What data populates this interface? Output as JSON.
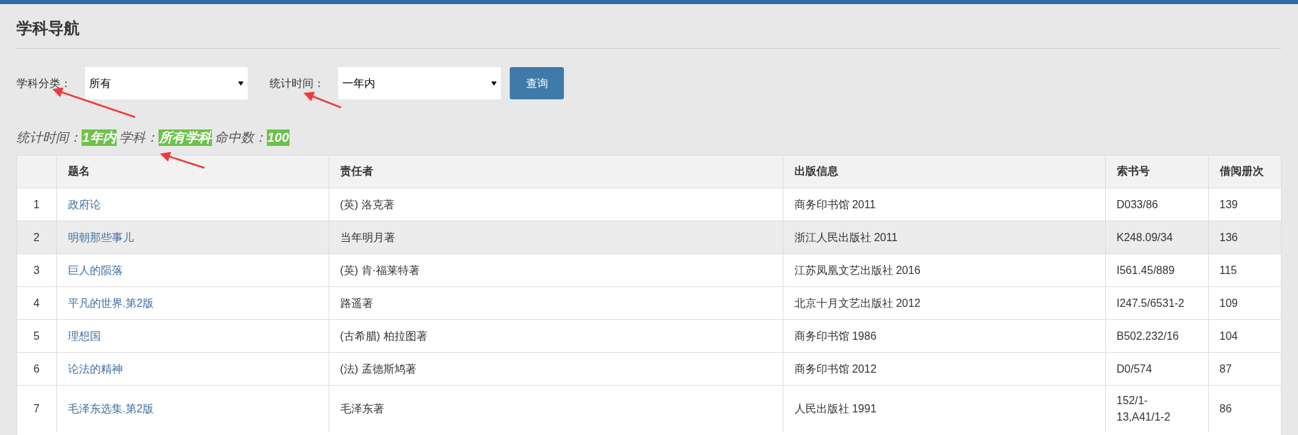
{
  "page_title": "学科导航",
  "filters": [
    {
      "label": "学科分类：",
      "value": "所有"
    },
    {
      "label": "统计时间：",
      "value": "一年内"
    }
  ],
  "query_button": "查询",
  "summary": [
    {
      "label": "统计时间：",
      "value": "1年内"
    },
    {
      "label": "学科：",
      "value": "所有学科"
    },
    {
      "label": "命中数：",
      "value": "100"
    }
  ],
  "table": {
    "columns": [
      "",
      "题名",
      "责任者",
      "出版信息",
      "索书号",
      "借阅册次"
    ],
    "rows": [
      {
        "index": "1",
        "title": "政府论",
        "author": "(英) 洛克著",
        "publication": "商务印书馆 2011",
        "call_number": "D033/86",
        "loans": "139",
        "highlighted": false
      },
      {
        "index": "2",
        "title": "明朝那些事儿",
        "author": "当年明月著",
        "publication": "浙江人民出版社 2011",
        "call_number": "K248.09/34",
        "loans": "136",
        "highlighted": true
      },
      {
        "index": "3",
        "title": "巨人的陨落",
        "author": "(英) 肯·福莱特著",
        "publication": "江苏凤凰文艺出版社 2016",
        "call_number": "I561.45/889",
        "loans": "115",
        "highlighted": false
      },
      {
        "index": "4",
        "title": "平凡的世界.第2版",
        "author": "路遥著",
        "publication": "北京十月文艺出版社 2012",
        "call_number": "I247.5/6531-2",
        "loans": "109",
        "highlighted": false
      },
      {
        "index": "5",
        "title": "理想国",
        "author": "(古希腊) 柏拉图著",
        "publication": "商务印书馆 1986",
        "call_number": "B502.232/16",
        "loans": "104",
        "highlighted": false
      },
      {
        "index": "6",
        "title": "论法的精神",
        "author": "(法) 孟德斯鸠著",
        "publication": "商务印书馆 2012",
        "call_number": "D0/574",
        "loans": "87",
        "highlighted": false
      },
      {
        "index": "7",
        "title": "毛泽东选集.第2版",
        "author": "毛泽东著",
        "publication": "人民出版社 1991",
        "call_number": "152/1-13,A41/1-2",
        "loans": "86",
        "highlighted": false
      }
    ]
  }
}
